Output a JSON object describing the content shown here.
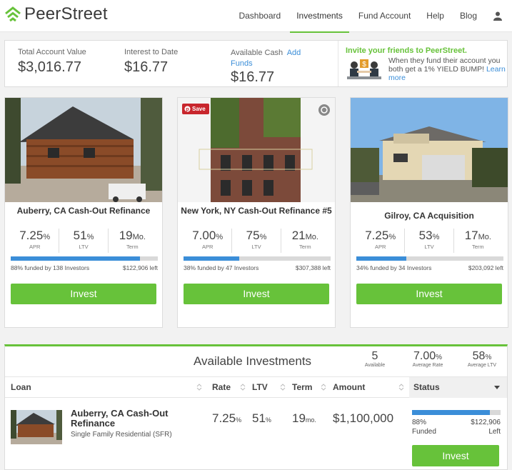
{
  "brand": {
    "name": "PeerStreet",
    "accent": "#67c23a",
    "link": "#3b8ed8"
  },
  "nav": {
    "items": [
      {
        "label": "Dashboard"
      },
      {
        "label": "Investments"
      },
      {
        "label": "Fund Account"
      },
      {
        "label": "Help"
      },
      {
        "label": "Blog"
      }
    ],
    "active": "Investments",
    "user_icon": "user-icon"
  },
  "summary": {
    "total_account_value": {
      "label": "Total Account Value",
      "value": "$3,016.77"
    },
    "interest_to_date": {
      "label": "Interest to Date",
      "value": "$16.77"
    },
    "available_cash": {
      "label": "Available Cash",
      "add_funds": "Add Funds",
      "value": "$16.77"
    },
    "invite": {
      "title": "Invite your friends to PeerStreet.",
      "text": "When they fund their account you both get a 1% YIELD BUMP!",
      "link": "Learn more"
    }
  },
  "cards": [
    {
      "title": "Auberry, CA Cash-Out Refinance",
      "rate": "7.25",
      "rate_unit": "%",
      "rate_label": "APR",
      "ltv": "51",
      "ltv_unit": "%",
      "ltv_label": "LTV",
      "term": "19",
      "term_unit": "Mo.",
      "term_label": "Term",
      "funded_fraction": 0.88,
      "funded_text": "88% funded by 138 Investors",
      "left_text": "$122,906 left",
      "button": "Invest"
    },
    {
      "title": "New York, NY Cash-Out Refinance #5",
      "save_label": "Save",
      "rate": "7.00",
      "rate_unit": "%",
      "rate_label": "APR",
      "ltv": "75",
      "ltv_unit": "%",
      "ltv_label": "LTV",
      "term": "21",
      "term_unit": "Mo.",
      "term_label": "Term",
      "funded_fraction": 0.38,
      "funded_text": "38% funded by 47 Investors",
      "left_text": "$307,388 left",
      "button": "Invest"
    },
    {
      "title": "Gilroy, CA Acquisition",
      "rate": "7.25",
      "rate_unit": "%",
      "rate_label": "APR",
      "ltv": "53",
      "ltv_unit": "%",
      "ltv_label": "LTV",
      "term": "17",
      "term_unit": "Mo.",
      "term_label": "Term",
      "funded_fraction": 0.34,
      "funded_text": "34% funded by 34 Investors",
      "left_text": "$203,092 left",
      "button": "Invest"
    }
  ],
  "available": {
    "title": "Available Investments",
    "stats": [
      {
        "value": "5",
        "unit": "",
        "label": "Available"
      },
      {
        "value": "7.00",
        "unit": "%",
        "label": "Average Rate"
      },
      {
        "value": "58",
        "unit": "%",
        "label": "Average LTV"
      }
    ],
    "columns": [
      "Loan",
      "Rate",
      "LTV",
      "Term",
      "Amount",
      "Status"
    ],
    "rows": [
      {
        "title": "Auberry, CA Cash-Out Refinance",
        "subtitle": "Single Family Residential (SFR)",
        "rate": "7.25",
        "rate_unit": "%",
        "ltv": "51",
        "ltv_unit": "%",
        "term": "19",
        "term_unit": "mo.",
        "amount": "$1,100,000",
        "funded_fraction": 0.88,
        "funded_pct": "88%",
        "funded_label": "Funded",
        "left_amount": "$122,906",
        "left_label": "Left",
        "button": "Invest"
      }
    ]
  }
}
